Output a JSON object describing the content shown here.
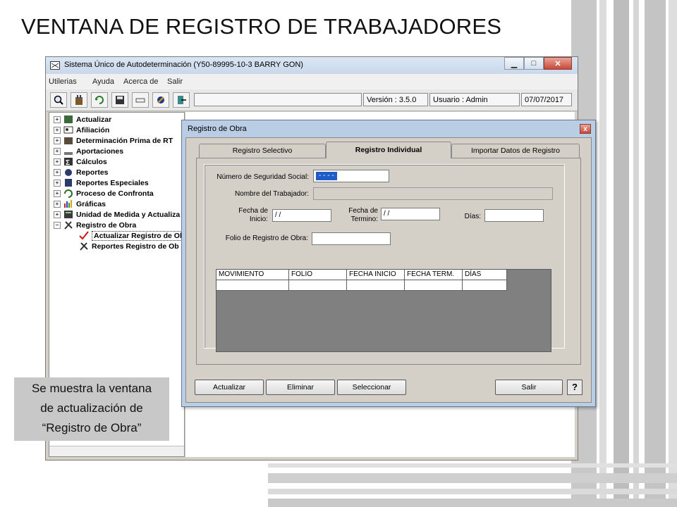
{
  "slide": {
    "title": "VENTANA DE REGISTRO DE TRABAJADORES",
    "caption_line1": "Se muestra la ventana",
    "caption_line2": "de actualización de",
    "caption_line3": "“Registro de Obra”"
  },
  "main_window": {
    "title": "Sistema Único de Autodeterminación (Y50-89995-10-3  BARRY GON)",
    "minimize": "▁",
    "maximize": "□",
    "close": "✕",
    "menu": [
      "Utilerias",
      "Ayuda",
      "Acerca de",
      "Salir"
    ],
    "status": {
      "version": "Versión : 3.5.0",
      "user": "Usuario : Admin",
      "date": "07/07/2017"
    },
    "tree": [
      {
        "label": "Actualizar",
        "expander": "+"
      },
      {
        "label": "Afiliación",
        "expander": "+"
      },
      {
        "label": "Determinación Prima de RT",
        "expander": "+"
      },
      {
        "label": "Aportaciones",
        "expander": "+"
      },
      {
        "label": "Cálculos",
        "expander": "+"
      },
      {
        "label": "Reportes",
        "expander": "+"
      },
      {
        "label": "Reportes Especiales",
        "expander": "+"
      },
      {
        "label": "Proceso de Confronta",
        "expander": "+"
      },
      {
        "label": "Gráficas",
        "expander": "+"
      },
      {
        "label": "Unidad de Medida y Actualiza",
        "expander": "+"
      },
      {
        "label": "Registro de Obra",
        "expander": "−"
      },
      {
        "label": "Actualizar Registro de Ob",
        "expander": ""
      },
      {
        "label": "Reportes Registro de Ob",
        "expander": ""
      }
    ]
  },
  "dialog": {
    "title": "Registro de Obra",
    "close": "x",
    "tabs": [
      "Registro Selectivo",
      "Registro Individual",
      "Importar Datos de Registro"
    ],
    "active_tab": "Registro Individual",
    "fields": {
      "nss_label": "Número de Seguridad Social:",
      "nss_value": " -  -  -  - ",
      "nombre_label": "Nombre del Trabajador:",
      "nombre_value": "",
      "fecha_inicio_label_1": "Fecha de",
      "fecha_inicio_label_2": "Inicio:",
      "fecha_inicio_value": " /  /",
      "fecha_termino_label_1": "Fecha de",
      "fecha_termino_label_2": "Termino:",
      "fecha_termino_value": " /  /",
      "dias_label": "Días:",
      "dias_value": "",
      "folio_label": "Folio de Registro de Obra:",
      "folio_value": ""
    },
    "grid": {
      "columns": [
        "MOVIMIENTO",
        "FOLIO",
        "FECHA INICIO",
        "FECHA TERM.",
        "DÍAS"
      ],
      "rows": [
        [
          "",
          "",
          "",
          "",
          ""
        ]
      ]
    },
    "buttons": {
      "actualizar": "Actualizar",
      "eliminar": "Eliminar",
      "seleccionar": "Seleccionar",
      "salir": "Salir",
      "help": "?"
    }
  },
  "icons": {
    "app": "app-icon",
    "toolbar": [
      "search-icon",
      "building-icon",
      "refresh-icon",
      "save-icon",
      "disk-icon",
      "db-icon",
      "exit-icon"
    ]
  }
}
